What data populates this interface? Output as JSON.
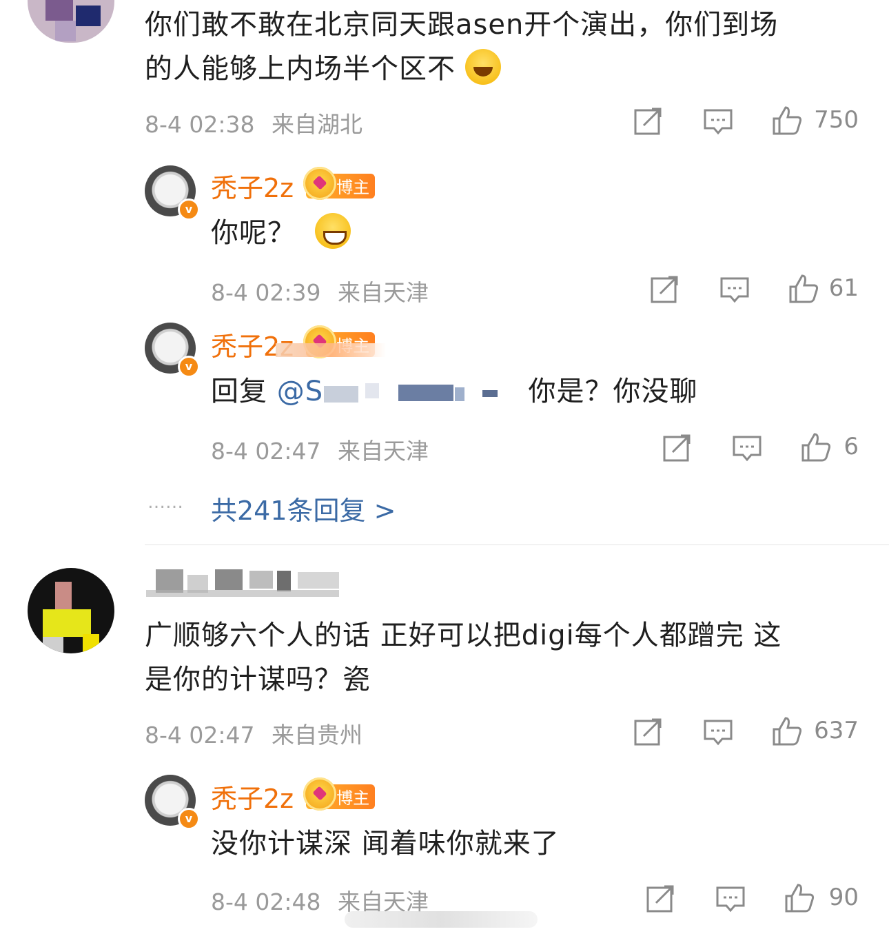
{
  "comments": [
    {
      "text_line1": "你们敢不敢在北京同天跟asen开个演出，你们到场",
      "text_line2": "的人能够上内场半个区不",
      "emoji_icon": "laughing-tears-emoji",
      "time": "8-4 02:38",
      "location": "来自湖北",
      "likes": "750"
    },
    {
      "text_line1": "广顺够六个人的话 正好可以把digi每个人都蹭完 这",
      "text_line2": "是你的计谋吗？瓷",
      "time": "8-4 02:47",
      "location": "来自贵州",
      "likes": "637"
    }
  ],
  "replies": [
    {
      "name": "秃子2z",
      "badge": "博主",
      "text": "你呢？",
      "emoji_icon": "grinning-emoji",
      "time": "8-4 02:39",
      "location": "来自天津",
      "likes": "61"
    },
    {
      "name": "秃子2z",
      "badge": "博主",
      "text_prefix": "回复",
      "mention": "@S",
      "text_suffix": "你是？你没聊",
      "time": "8-4 02:47",
      "location": "来自天津",
      "likes": "6"
    },
    {
      "name": "秃子2z",
      "badge": "博主",
      "text": "没你计谋深 闻着味你就来了",
      "time": "8-4 02:48",
      "location": "来自天津",
      "likes": "90"
    }
  ],
  "more_replies": {
    "dots": "……",
    "label": "共241条回复 >"
  },
  "icons": {
    "share": "share-icon",
    "comment": "comment-icon",
    "like": "thumbs-up-icon"
  },
  "colors": {
    "name": "#f0700a",
    "link": "#3b6aa5",
    "meta": "#9a9a9a"
  }
}
